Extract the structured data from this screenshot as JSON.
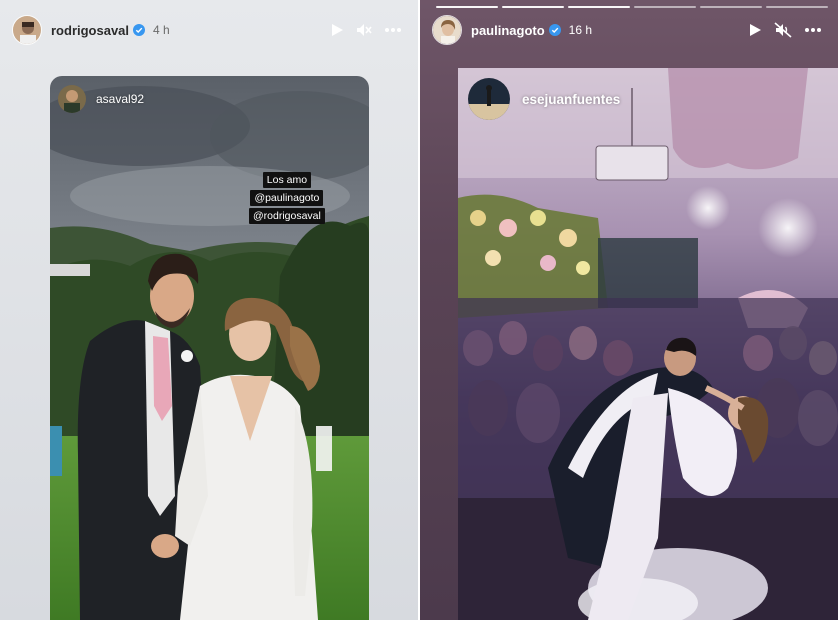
{
  "left_story": {
    "username": "rodrigosaval",
    "time": "4 h",
    "reshared_user": "asaval92",
    "tags": [
      "Los amo",
      "@paulinagoto",
      "@rodrigosaval"
    ],
    "icons": {
      "play": "play-icon",
      "mute": "sound-on-icon",
      "more": "more-options-icon",
      "verified": "verified-badge-icon"
    }
  },
  "right_story": {
    "username": "paulinagoto",
    "time": "16 h",
    "reshared_user": "esejuanfuentes",
    "icons": {
      "play": "play-icon",
      "mute": "sound-off-icon",
      "more": "more-options-icon",
      "verified": "verified-badge-icon"
    }
  },
  "colors": {
    "verified": "#3897f0",
    "left_bg": "#e2e4e7",
    "right_bg": "#5a4455"
  }
}
